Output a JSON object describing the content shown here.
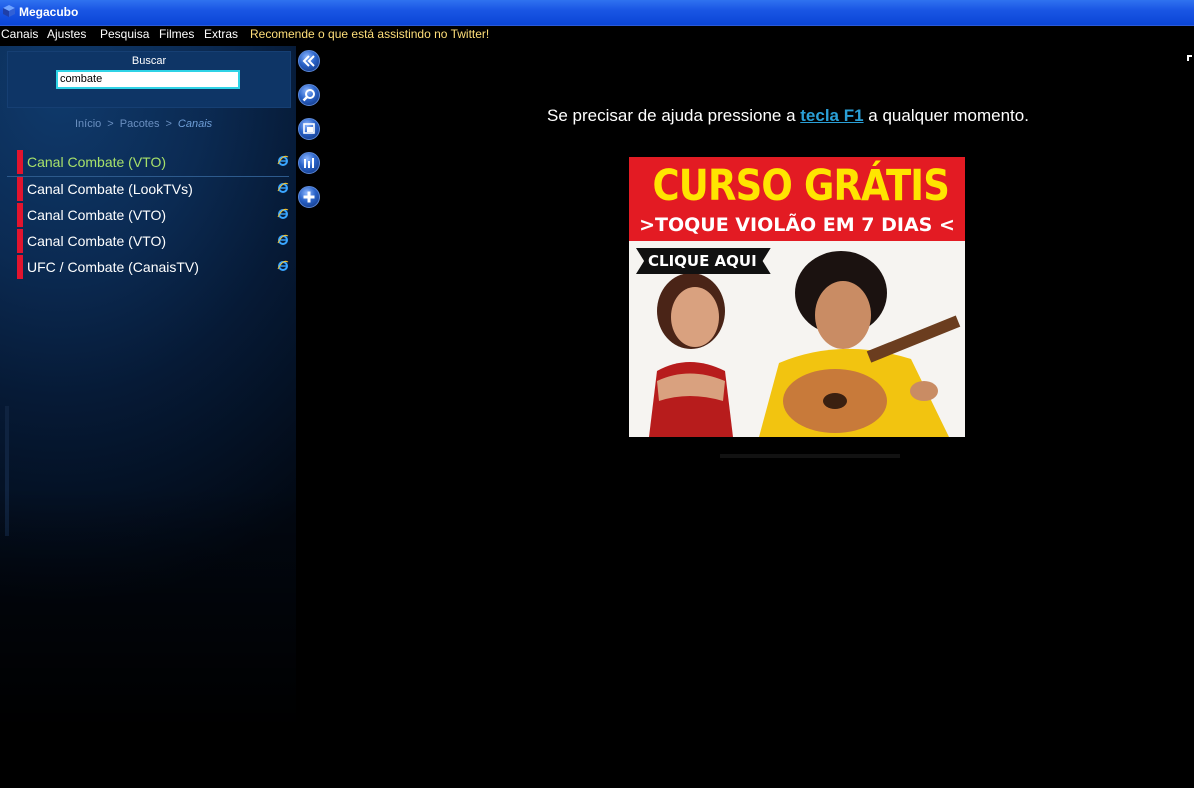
{
  "window": {
    "title": "Megacubo"
  },
  "menu": [
    {
      "label": "Canais"
    },
    {
      "label": "Ajustes"
    },
    {
      "label": "Pesquisa"
    },
    {
      "label": "Filmes"
    },
    {
      "label": "Extras"
    },
    {
      "label": "Recomende o que está assistindo no Twitter!"
    }
  ],
  "search": {
    "label": "Buscar",
    "value": "combate"
  },
  "breadcrumb": {
    "items": [
      "Início",
      "Pacotes"
    ],
    "current": "Canais",
    "separator": ">"
  },
  "channels": [
    {
      "label": "Canal Combate (VTO)",
      "selected": true
    },
    {
      "label": "Canal Combate (LookTVs)"
    },
    {
      "label": "Canal Combate (VTO)"
    },
    {
      "label": "Canal Combate (VTO)"
    },
    {
      "label": "UFC / Combate (CanaisTV)"
    }
  ],
  "tools": [
    {
      "icon": "back-icon"
    },
    {
      "icon": "search-icon"
    },
    {
      "icon": "window-icon"
    },
    {
      "icon": "equalizer-icon"
    },
    {
      "icon": "add-icon"
    }
  ],
  "main": {
    "help_prefix": "Se precisar de ajuda pressione a ",
    "help_key": "tecla F1",
    "help_suffix": " a qualquer momento."
  },
  "ad": {
    "headline": "CURSO GRÁTIS",
    "subline": ">TOQUE VIOLÃO EM 7 DIAS <",
    "cta": "CLIQUE AQUI"
  },
  "colors": {
    "titlebar": "#1a56e4",
    "selected_channel": "#a7e16a",
    "channel_bar": "#e2142e",
    "search_border": "#2fd3e6",
    "ad_red": "#e31b23",
    "ad_yellow": "#ffe500",
    "link": "#2a9fd6"
  }
}
